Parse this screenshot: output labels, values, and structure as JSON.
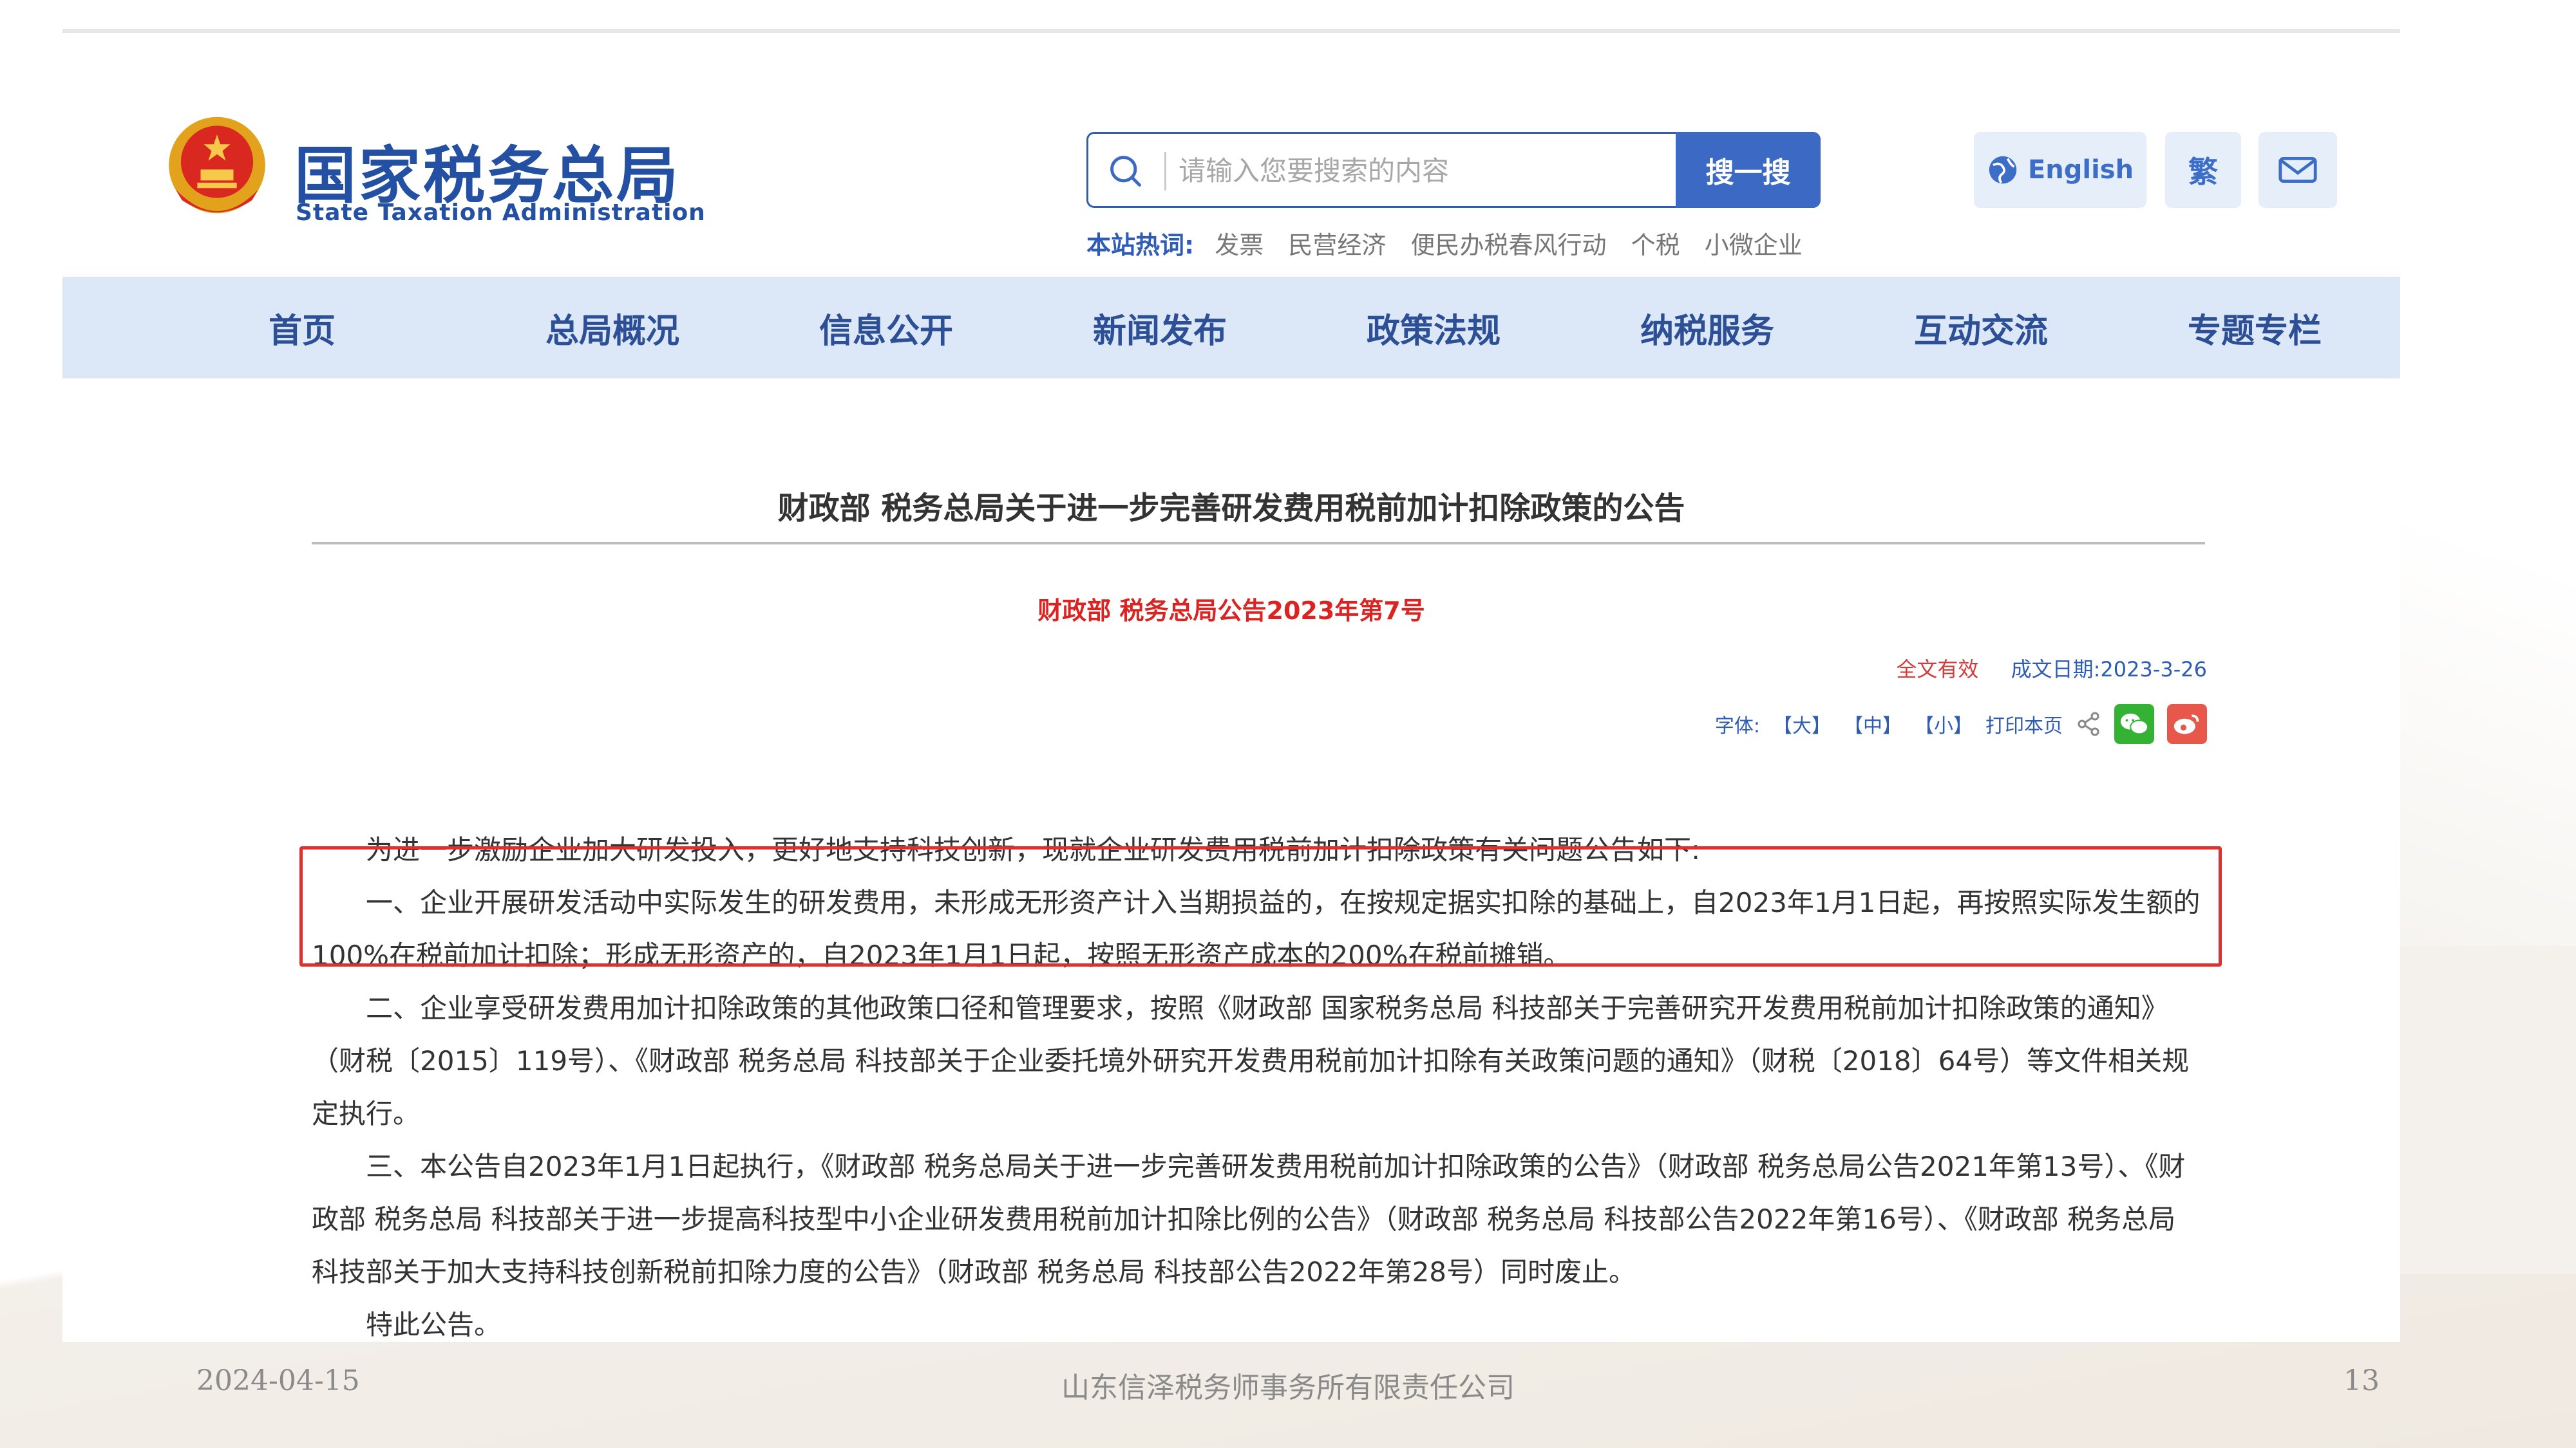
{
  "slide": {
    "date": "2024-04-15",
    "company": "山东信泽税务师事务所有限责任公司",
    "page": "13"
  },
  "header": {
    "logo_cn": "国家税务总局",
    "logo_en": "State Taxation Administration",
    "search_placeholder": "请输入您要搜索的内容",
    "search_button": "搜一搜",
    "english_button": "English",
    "traditional_button": "繁",
    "hotwords_label": "本站热词:",
    "hotwords": [
      "发票",
      "民营经济",
      "便民办税春风行动",
      "个税",
      "小微企业"
    ]
  },
  "nav": {
    "items": [
      "首页",
      "总局概况",
      "信息公开",
      "新闻发布",
      "政策法规",
      "纳税服务",
      "互动交流",
      "专题专栏"
    ]
  },
  "article": {
    "title": "财政部 税务总局关于进一步完善研发费用税前加计扣除政策的公告",
    "doc_number": "财政部 税务总局公告2023年第7号",
    "validity": "全文有效",
    "date_label": "成文日期:",
    "date": "2023-3-26",
    "font_label": "字体:",
    "font_large": "【大】",
    "font_medium": "【中】",
    "font_small": "【小】",
    "print": "打印本页",
    "paragraphs": [
      "为进一步激励企业加大研发投入，更好地支持科技创新，现就企业研发费用税前加计扣除政策有关问题公告如下:",
      "一、企业开展研发活动中实际发生的研发费用，未形成无形资产计入当期损益的，在按规定据实扣除的基础上，自2023年1月1日起，再按照实际发生额的100%在税前加计扣除；形成无形资产的，自2023年1月1日起，按照无形资产成本的200%在税前摊销。",
      "二、企业享受研发费用加计扣除政策的其他政策口径和管理要求，按照《财政部 国家税务总局 科技部关于完善研究开发费用税前加计扣除政策的通知》（财税〔2015〕119号）、《财政部 税务总局 科技部关于企业委托境外研究开发费用税前加计扣除有关政策问题的通知》（财税〔2018〕64号）等文件相关规定执行。",
      "三、本公告自2023年1月1日起执行，《财政部 税务总局关于进一步完善研发费用税前加计扣除政策的公告》（财政部 税务总局公告2021年第13号）、《财政部 税务总局 科技部关于进一步提高科技型中小企业研发费用税前加计扣除比例的公告》（财政部 税务总局 科技部公告2022年第16号）、《财政部 税务总局 科技部关于加大支持科技创新税前扣除力度的公告》（财政部 税务总局 科技部公告2022年第28号）同时废止。",
      "特此公告。"
    ]
  }
}
